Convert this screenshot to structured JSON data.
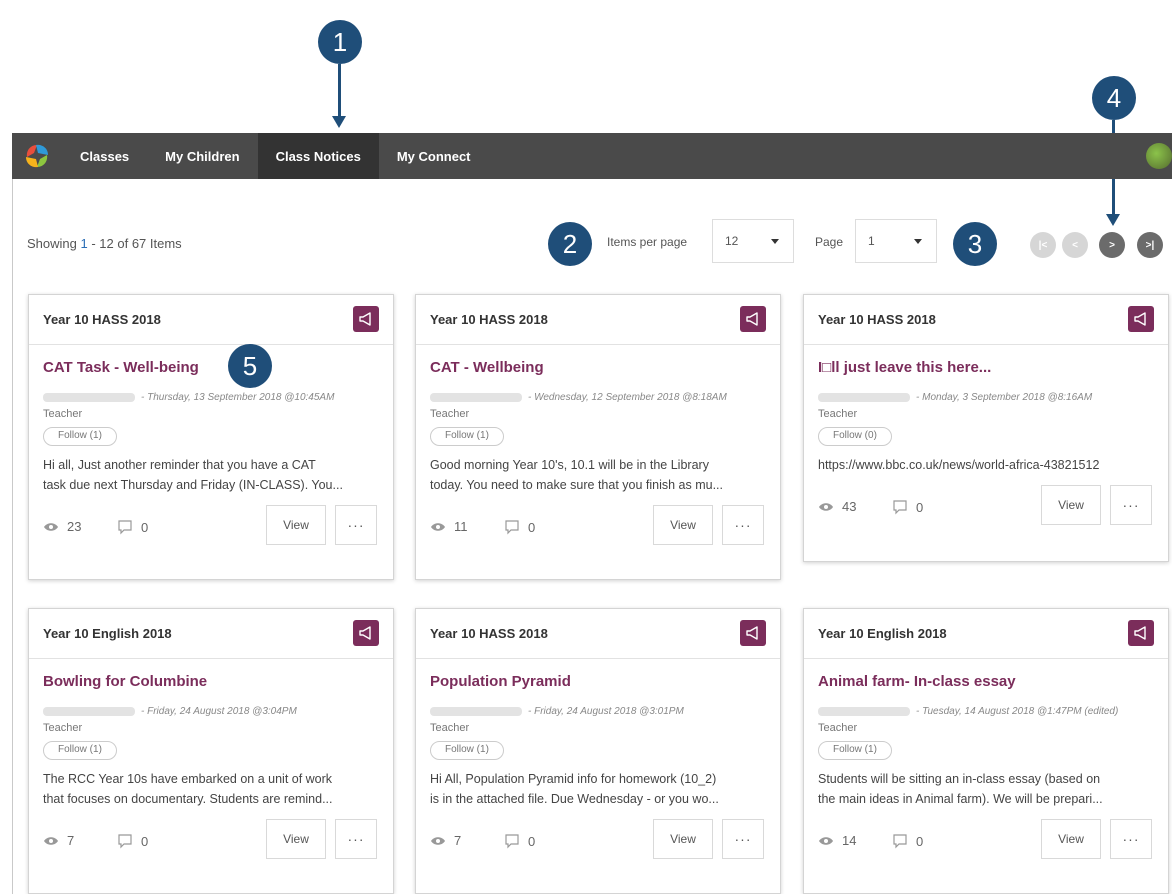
{
  "nav": {
    "items": [
      {
        "label": "Classes",
        "active": false
      },
      {
        "label": "My Children",
        "active": false
      },
      {
        "label": "Class Notices",
        "active": true
      },
      {
        "label": "My Connect",
        "active": false
      }
    ]
  },
  "listing": {
    "showing_prefix": "Showing ",
    "range_start": "1",
    "range_sep": " - ",
    "range_end": "12",
    "of_text": " of 67 Items",
    "items_per_page_label": "Items per page",
    "items_per_page_value": "12",
    "page_label": "Page",
    "page_value": "1"
  },
  "pager": {
    "first": "|<",
    "prev": "<",
    "next": ">",
    "last": ">|"
  },
  "callouts": [
    "1",
    "2",
    "3",
    "4",
    "5"
  ],
  "colors": {
    "navbar": "#4a4a4a",
    "accent": "#7b2d5b",
    "callout": "#1f4e79"
  },
  "icons": {
    "notice": "megaphone-icon",
    "views": "eye-icon",
    "comments": "comment-icon"
  },
  "cards": [
    {
      "class": "Year 10 HASS 2018",
      "title": "CAT Task - Well-being",
      "meta": "- Thursday, 13 September 2018 @10:45AM",
      "role": "Teacher",
      "follow": "Follow (1)",
      "excerpt1": "Hi all, Just another reminder that you have a CAT",
      "excerpt2": "task due next Thursday and Friday (IN-CLASS). You...",
      "views": "23",
      "comments": "0",
      "view_label": "View",
      "more_label": "···"
    },
    {
      "class": "Year 10 HASS 2018",
      "title": "CAT - Wellbeing",
      "meta": "- Wednesday, 12 September 2018 @8:18AM",
      "role": "Teacher",
      "follow": "Follow (1)",
      "excerpt1": "Good morning Year 10's, 10.1 will be in the Library",
      "excerpt2": "today. You need to make sure that you finish as mu...",
      "views": "11",
      "comments": "0",
      "view_label": "View",
      "more_label": "···"
    },
    {
      "class": "Year 10 HASS 2018",
      "title": "I□ll just leave this here...",
      "meta": "- Monday, 3 September 2018 @8:16AM",
      "role": "Teacher",
      "follow": "Follow (0)",
      "excerpt1": "https://www.bbc.co.uk/news/world-africa-43821512",
      "excerpt2": "",
      "views": "43",
      "comments": "0",
      "view_label": "View",
      "more_label": "···"
    },
    {
      "class": "Year 10 English 2018",
      "title": "Bowling for Columbine",
      "meta": "- Friday, 24 August 2018 @3:04PM",
      "role": "Teacher",
      "follow": "Follow (1)",
      "excerpt1": "The RCC Year 10s have embarked on a unit of work",
      "excerpt2": "that focuses on documentary. Students are remind...",
      "views": "7",
      "comments": "0",
      "view_label": "View",
      "more_label": "···"
    },
    {
      "class": "Year 10 HASS 2018",
      "title": "Population Pyramid",
      "meta": "- Friday, 24 August 2018 @3:01PM",
      "role": "Teacher",
      "follow": "Follow (1)",
      "excerpt1": "Hi All, Population Pyramid info for homework (10_2)",
      "excerpt2": "is in the attached file. Due Wednesday - or you wo...",
      "views": "7",
      "comments": "0",
      "view_label": "View",
      "more_label": "···"
    },
    {
      "class": "Year 10 English 2018",
      "title": "Animal farm- In-class essay",
      "meta": "- Tuesday, 14 August 2018 @1:47PM (edited)",
      "role": "Teacher",
      "follow": "Follow (1)",
      "excerpt1": "Students will be sitting an in-class essay (based on",
      "excerpt2": "the main ideas in Animal farm). We will be prepari...",
      "views": "14",
      "comments": "0",
      "view_label": "View",
      "more_label": "···"
    }
  ]
}
